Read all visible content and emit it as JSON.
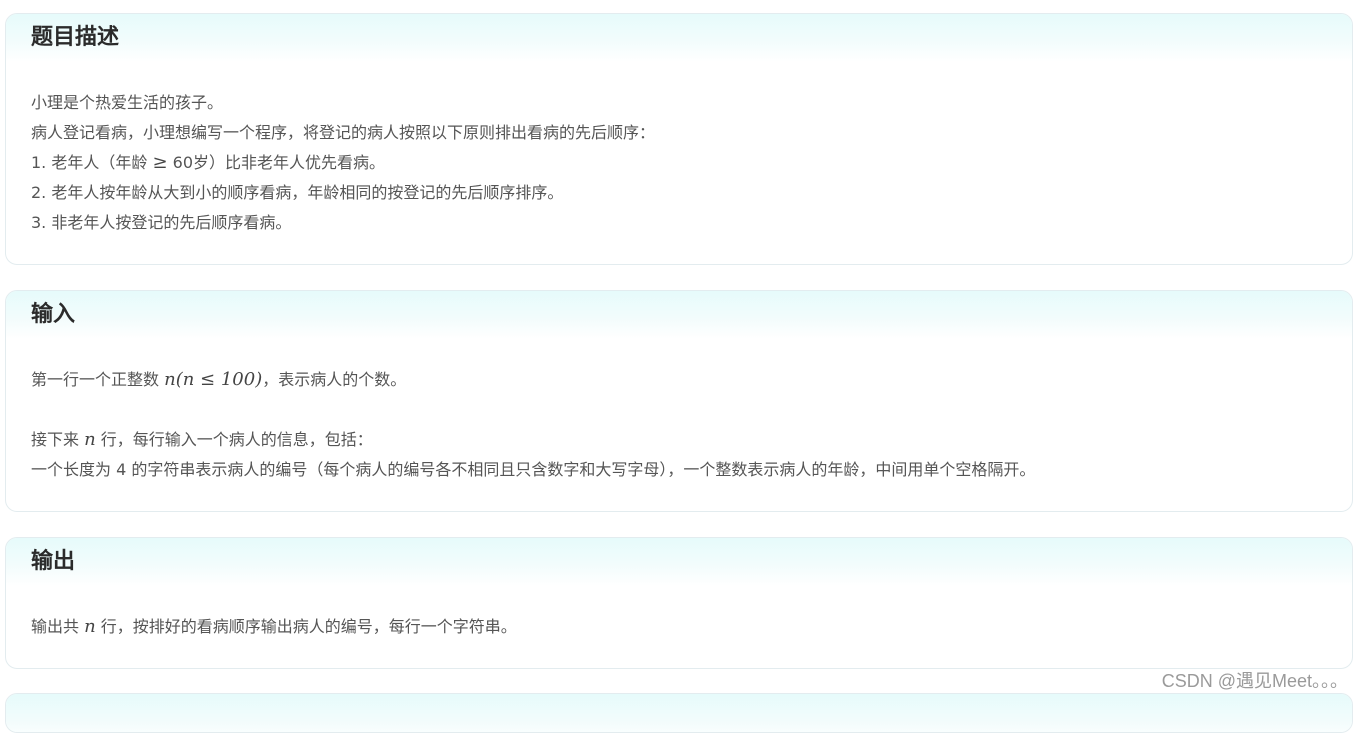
{
  "description": {
    "heading": "题目描述",
    "lines": [
      "小理是个热爱生活的孩子。",
      "病人登记看病，小理想编写一个程序，将登记的病人按照以下原则排出看病的先后顺序：",
      "1. 老年人（年龄",
      "≥",
      "60岁）比非老年人优先看病。",
      "2. 老年人按年龄从大到小的顺序看病，年龄相同的按登记的先后顺序排序。",
      "3. 非老年人按登记的先后顺序看病。"
    ]
  },
  "input": {
    "heading": "输入",
    "line1_pre": "第一行一个正整数",
    "line1_var": "n",
    "line1_math": "(n ≤ 100)",
    "line1_post": "，表示病人的个数。",
    "line2_pre": "接下来",
    "line2_var": "n",
    "line2_post": "行，每行输入一个病人的信息，包括：",
    "line3": "一个长度为 4 的字符串表示病人的编号（每个病人的编号各不相同且只含数字和大写字母），一个整数表示病人的年龄，中间用单个空格隔开。"
  },
  "output": {
    "heading": "输出",
    "line_pre": "输出共",
    "line_var": "n",
    "line_post": "行，按排好的看病顺序输出病人的编号，每行一个字符串。"
  },
  "watermark": "CSDN @遇见Meet。。。"
}
